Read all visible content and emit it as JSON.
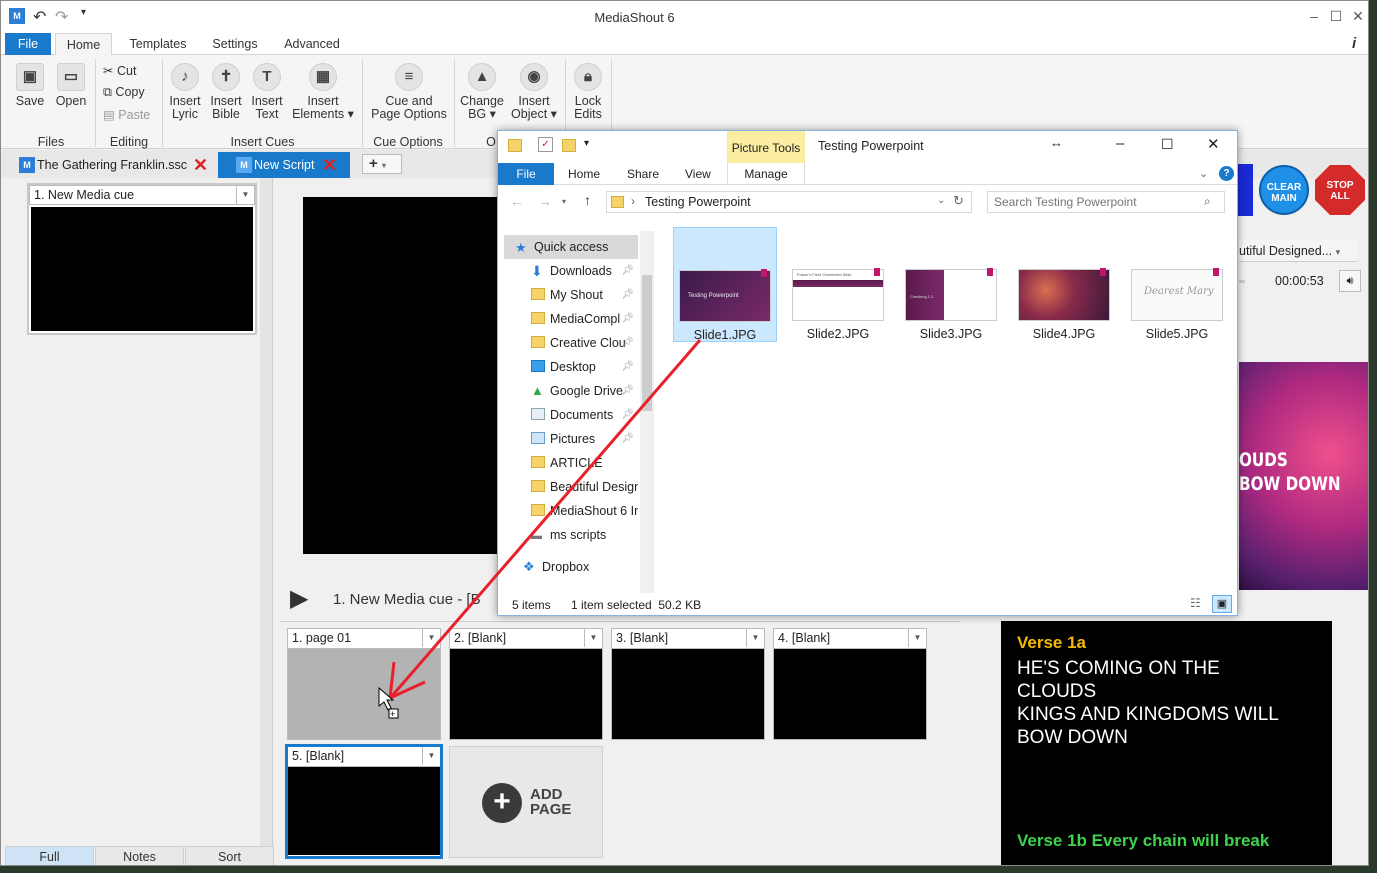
{
  "app": {
    "title": "MediaShout 6",
    "tabs": [
      "File",
      "Home",
      "Templates",
      "Settings",
      "Advanced"
    ],
    "ribbon": {
      "files": {
        "group": "Files",
        "save": "Save",
        "open": "Open"
      },
      "editing": {
        "group": "Editing",
        "cut": "Cut",
        "copy": "Copy",
        "paste": "Paste"
      },
      "insert_cues": {
        "group": "Insert Cues",
        "lyric": [
          "Insert",
          "Lyric"
        ],
        "bible": [
          "Insert",
          "Bible"
        ],
        "text": [
          "Insert",
          "Text"
        ],
        "elements": [
          "Insert",
          "Elements"
        ]
      },
      "cue_options": {
        "group": "Cue Options",
        "label": [
          "Cue and",
          "Page Options"
        ]
      },
      "change_bg": [
        "Change",
        "BG"
      ],
      "insert_object": [
        "Insert",
        "Object"
      ],
      "lock_edits": [
        "Lock",
        "Edits"
      ],
      "group_partial": "O"
    },
    "doc_tabs": [
      "The Gathering Franklin.ssc",
      "New Script"
    ],
    "left": {
      "cue": "1. New Media cue",
      "bottom_tabs": [
        "Full",
        "Notes",
        "Sort"
      ]
    },
    "center": {
      "cue_title": "1. New Media cue",
      "cue_title_suffix": "-  [B",
      "pages": [
        "1. page 01",
        "2. [Blank]",
        "3. [Blank]",
        "4. [Blank]",
        "5. [Blank]"
      ],
      "add_page": [
        "ADD",
        "PAGE"
      ]
    },
    "right": {
      "clear_main": [
        "CLEAR",
        "MAIN"
      ],
      "stop_all": [
        "STOP",
        "ALL"
      ],
      "dropdown": "utiful Designed...",
      "time": "00:00:53",
      "preview_text": [
        "OUDS",
        "BOW DOWN"
      ],
      "lyrics": {
        "verse1a_label": "Verse 1a",
        "lines": [
          "HE'S COMING ON THE",
          "CLOUDS",
          "KINGS AND KINGDOMS WILL",
          "BOW DOWN"
        ],
        "verse1b": "Verse 1b Every chain will break"
      }
    }
  },
  "explorer": {
    "title": "Testing Powerpoint",
    "picture_tools": "Picture Tools",
    "tabs": [
      "File",
      "Home",
      "Share",
      "View",
      "Manage"
    ],
    "path": "Testing Powerpoint",
    "search_placeholder": "Search Testing Powerpoint",
    "nav": [
      "Quick access",
      "Downloads",
      "My Shout",
      "MediaCompl",
      "Creative Clou",
      "Desktop",
      "Google Drive",
      "Documents",
      "Pictures",
      "ARTICLE",
      "Beautiful Design",
      "MediaShout 6 In",
      "ms scripts",
      "Dropbox"
    ],
    "files": [
      "Slide1.JPG",
      "Slide2.JPG",
      "Slide3.JPG",
      "Slide4.JPG",
      "Slide5.JPG"
    ],
    "thumb_texts": [
      "Testing Powerpoint",
      "Fraser's Field Checkered Slide",
      "Checking 1 2",
      "Dearest Mary"
    ],
    "status": {
      "count": "5 items",
      "selected": "1 item selected  50.2 KB"
    }
  },
  "colors": {
    "accent": "#1979ca",
    "selection": "#cce8ff",
    "verse_label": "#f5b800",
    "verse1b": "#3dd34d",
    "clear_main": "#1e90e8",
    "stop_all": "#d42a2a",
    "drag_arrow": "#e8202a"
  }
}
